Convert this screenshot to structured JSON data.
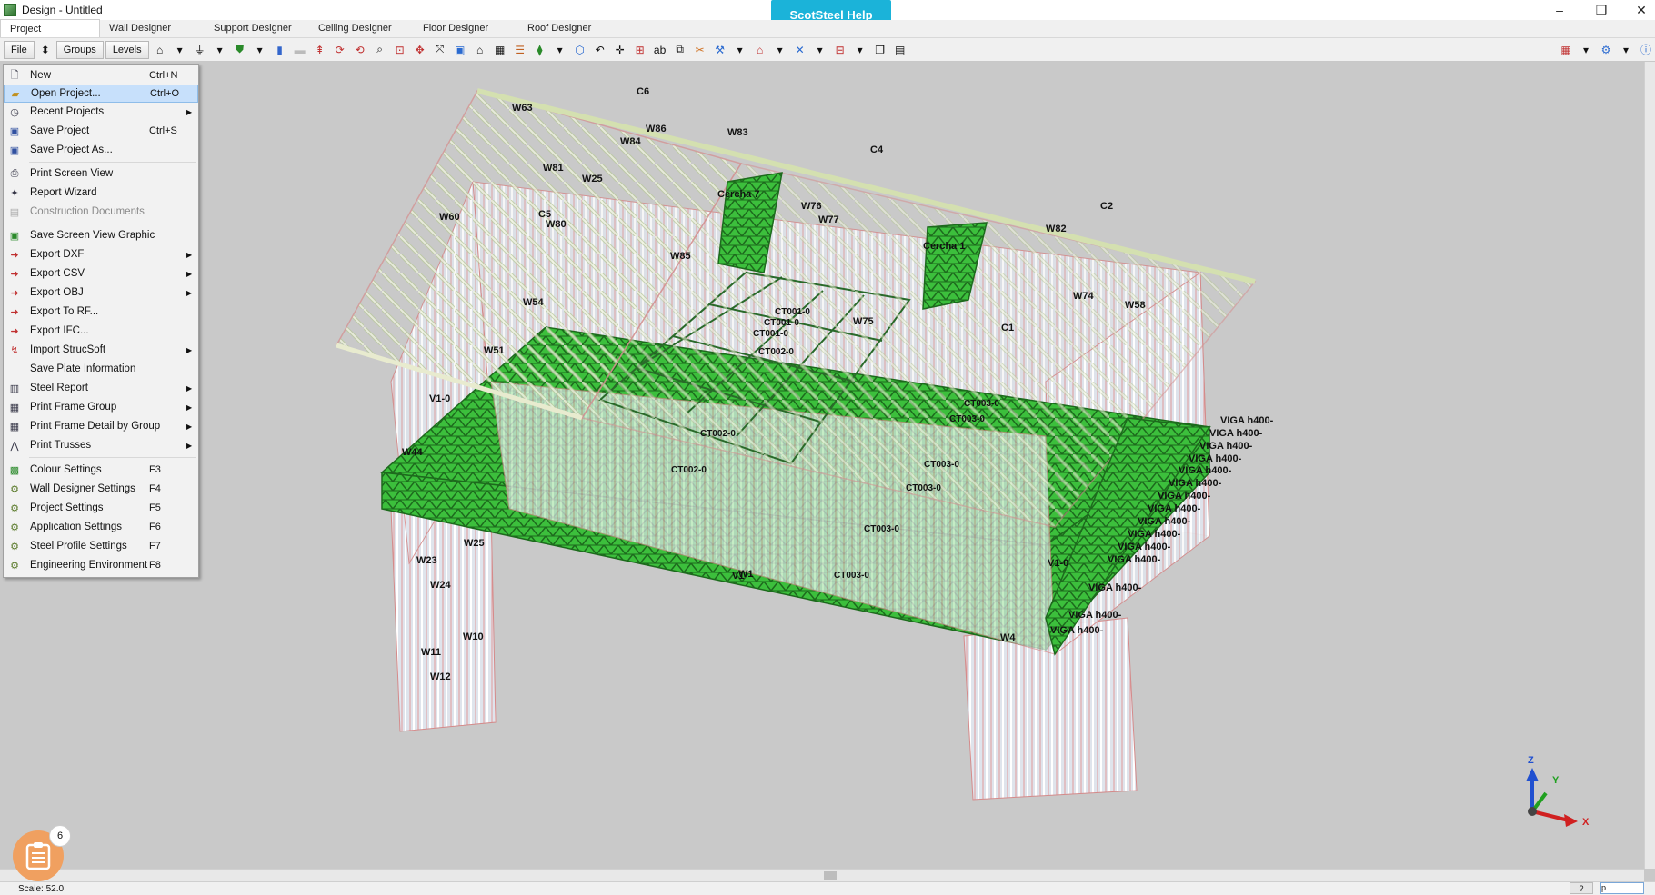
{
  "window": {
    "title": "Design - Untitled",
    "help_button": "ScotSteel Help",
    "controls": {
      "minimize": "–",
      "restore": "❐",
      "close": "✕"
    }
  },
  "tabs": [
    "Project",
    "Wall Designer",
    "Support Designer",
    "Ceiling Designer",
    "Floor Designer",
    "Roof Designer"
  ],
  "toolbar": {
    "file": "File",
    "groups": "Groups",
    "levels": "Levels"
  },
  "menu": {
    "items": [
      {
        "label": "New",
        "shortcut": "Ctrl+N",
        "icon": "new-file-icon"
      },
      {
        "label": "Open Project...",
        "shortcut": "Ctrl+O",
        "icon": "folder-icon",
        "highlighted": true
      },
      {
        "label": "Recent Projects",
        "icon": "clock-icon",
        "submenu": true
      },
      {
        "label": "Save Project",
        "shortcut": "Ctrl+S",
        "icon": "save-icon"
      },
      {
        "label": "Save Project As...",
        "icon": "save-as-icon"
      },
      {
        "label": "Print Screen View",
        "icon": "printer-icon"
      },
      {
        "label": "Report Wizard",
        "icon": "wizard-icon"
      },
      {
        "label": "Construction Documents",
        "icon": "document-icon",
        "disabled": true
      },
      {
        "label": "Save Screen View Graphic",
        "icon": "save-graphic-icon"
      },
      {
        "label": "Export DXF",
        "icon": "export-icon",
        "submenu": true
      },
      {
        "label": "Export CSV",
        "icon": "export-icon",
        "submenu": true
      },
      {
        "label": "Export OBJ",
        "icon": "export-icon",
        "submenu": true
      },
      {
        "label": "Export To RF...",
        "icon": "export-icon"
      },
      {
        "label": "Export IFC...",
        "icon": "export-icon"
      },
      {
        "label": "Import StrucSoft",
        "icon": "import-icon",
        "submenu": true
      },
      {
        "label": "Save Plate Information",
        "icon": ""
      },
      {
        "label": "Steel Report",
        "icon": "report-icon",
        "submenu": true
      },
      {
        "label": "Print Frame Group",
        "icon": "grid-icon",
        "submenu": true
      },
      {
        "label": "Print Frame Detail by Group",
        "icon": "grid-icon",
        "submenu": true
      },
      {
        "label": "Print Trusses",
        "icon": "truss-icon",
        "submenu": true
      },
      {
        "label": "Colour Settings",
        "shortcut": "F3",
        "icon": "palette-icon"
      },
      {
        "label": "Wall Designer Settings",
        "shortcut": "F4",
        "icon": "settings-icon"
      },
      {
        "label": "Project Settings",
        "shortcut": "F5",
        "icon": "settings-icon"
      },
      {
        "label": "Application Settings",
        "shortcut": "F6",
        "icon": "settings-icon"
      },
      {
        "label": "Steel Profile Settings",
        "shortcut": "F7",
        "icon": "settings-icon"
      },
      {
        "label": "Engineering Environment",
        "shortcut": "F8",
        "icon": "settings-icon"
      }
    ]
  },
  "labels": {
    "walls": [
      "W63",
      "W86",
      "W83",
      "W84",
      "W81",
      "W25",
      "W77",
      "W60",
      "W80",
      "W85",
      "W76",
      "W82",
      "W74",
      "W58",
      "W75",
      "W54",
      "W51",
      "W44",
      "W25",
      "W23",
      "W24",
      "W10",
      "W11",
      "W12",
      "W4",
      "W1"
    ],
    "components": [
      "C6",
      "C4",
      "C2",
      "C5",
      "C1"
    ],
    "cercha": [
      "Cercha 7",
      "Cercha 1"
    ],
    "ct": [
      "CT001-0",
      "CT001-0",
      "CT001-0",
      "CT002-0",
      "CT002-0",
      "CT002-0",
      "CT003-0",
      "CT003-0",
      "CT003-0",
      "CT003-0",
      "CT003-0",
      "CT003-0"
    ],
    "viga": [
      "VIGA h400-",
      "VIGA h400-",
      "VIGA h400-",
      "VIGA h400-",
      "VIGA h400-",
      "VIGA h400-",
      "VIGA h400-",
      "VIGA h400-",
      "VIGA h400-",
      "VIGA h400-",
      "VIGA h400-",
      "VIGA h400-",
      "VIGA h400-",
      "VIGA h400-",
      "VIGA h400-"
    ],
    "misc": [
      "V1-0",
      "V1",
      "V1-0"
    ]
  },
  "axes": {
    "z": "Z",
    "y": "Y",
    "x": "X"
  },
  "status": {
    "scale": "Scale: 52.0",
    "help": "?",
    "input": "p"
  },
  "notification_count": "6",
  "colors": {
    "accent": "#1bb3d9",
    "floor": "#2ea82e",
    "roof": "#e8e8c0",
    "wall_lines": "#e2a8a8",
    "highlight": "#c7e0fb"
  }
}
